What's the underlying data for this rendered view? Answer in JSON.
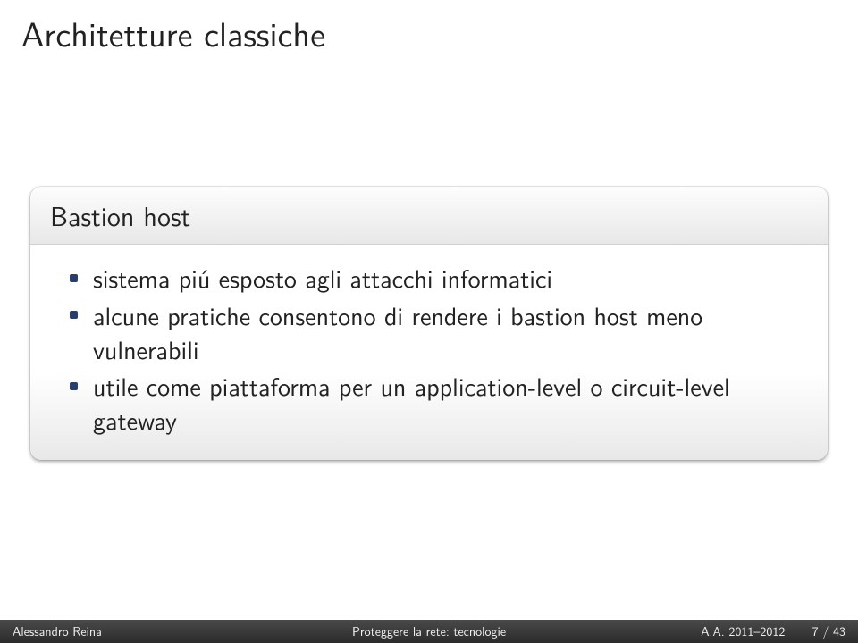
{
  "title": "Architetture classiche",
  "block": {
    "heading": "Bastion host",
    "items": [
      "sistema piú esposto agli attacchi informatici",
      "alcune pratiche consentono di rendere i bastion host meno vulnerabili",
      "utile come piattaforma per un application-level o circuit-level gateway"
    ]
  },
  "footer": {
    "author": "Alessandro Reina",
    "topic": "Proteggere la rete: tecnologie",
    "date": "A.A. 2011–2012",
    "page": "7 / 43"
  }
}
